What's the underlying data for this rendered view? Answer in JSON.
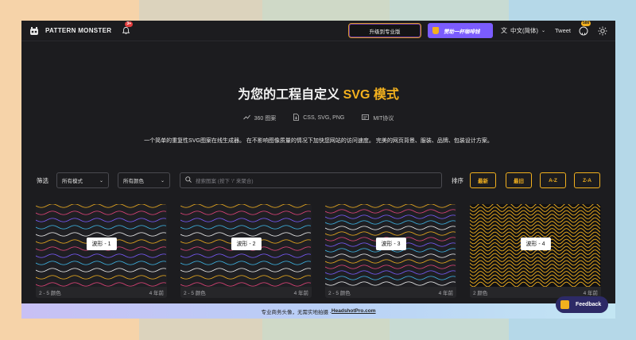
{
  "nav": {
    "brand": "PATTERN MONSTER",
    "notification_count": "3+",
    "upgrade_label": "升级到专业版",
    "coffee_label": "赞助一杯咖啡钱",
    "language": "中文(简体)",
    "tweet": "Tweet",
    "github_count": "586"
  },
  "hero": {
    "title_main": "为您的工程自定义 ",
    "title_accent": "SVG 模式",
    "stats": [
      "360 图案",
      "CSS, SVG, PNG",
      "MIT协议"
    ],
    "description": "一个简单的重复性SVG图案在线生成器。 在不影响图像质量的情况下加快您网站的访问速度。 完美的网页背景、服装、品牌、包装设计方案。"
  },
  "filters": {
    "label": "筛选",
    "mode": "所有模式",
    "color": "所有颜色",
    "search_placeholder": "搜索图案 (按下 '/' 来聚合)",
    "sort_label": "排序",
    "sort_buttons": [
      "最新",
      "最旧",
      "A-Z",
      "Z-A"
    ]
  },
  "cards": [
    {
      "label": "波形 - 1",
      "colors": "2 - 5 颜色",
      "age": "4 年前"
    },
    {
      "label": "波形 - 2",
      "colors": "2 - 5 颜色",
      "age": "4 年前"
    },
    {
      "label": "波形 - 3",
      "colors": "2 - 5 颜色",
      "age": "4 年前"
    },
    {
      "label": "波形 - 4",
      "colors": "2 颜色",
      "age": "4 年前"
    }
  ],
  "footer": {
    "text": "专业商务头像，无需实地拍摄 - ",
    "link": "HeadshotPro.com"
  },
  "feedback": "Feedback",
  "colors": {
    "accent": "#f2b01e",
    "background": "#1c1c1f",
    "purple": "#7b5cff"
  }
}
